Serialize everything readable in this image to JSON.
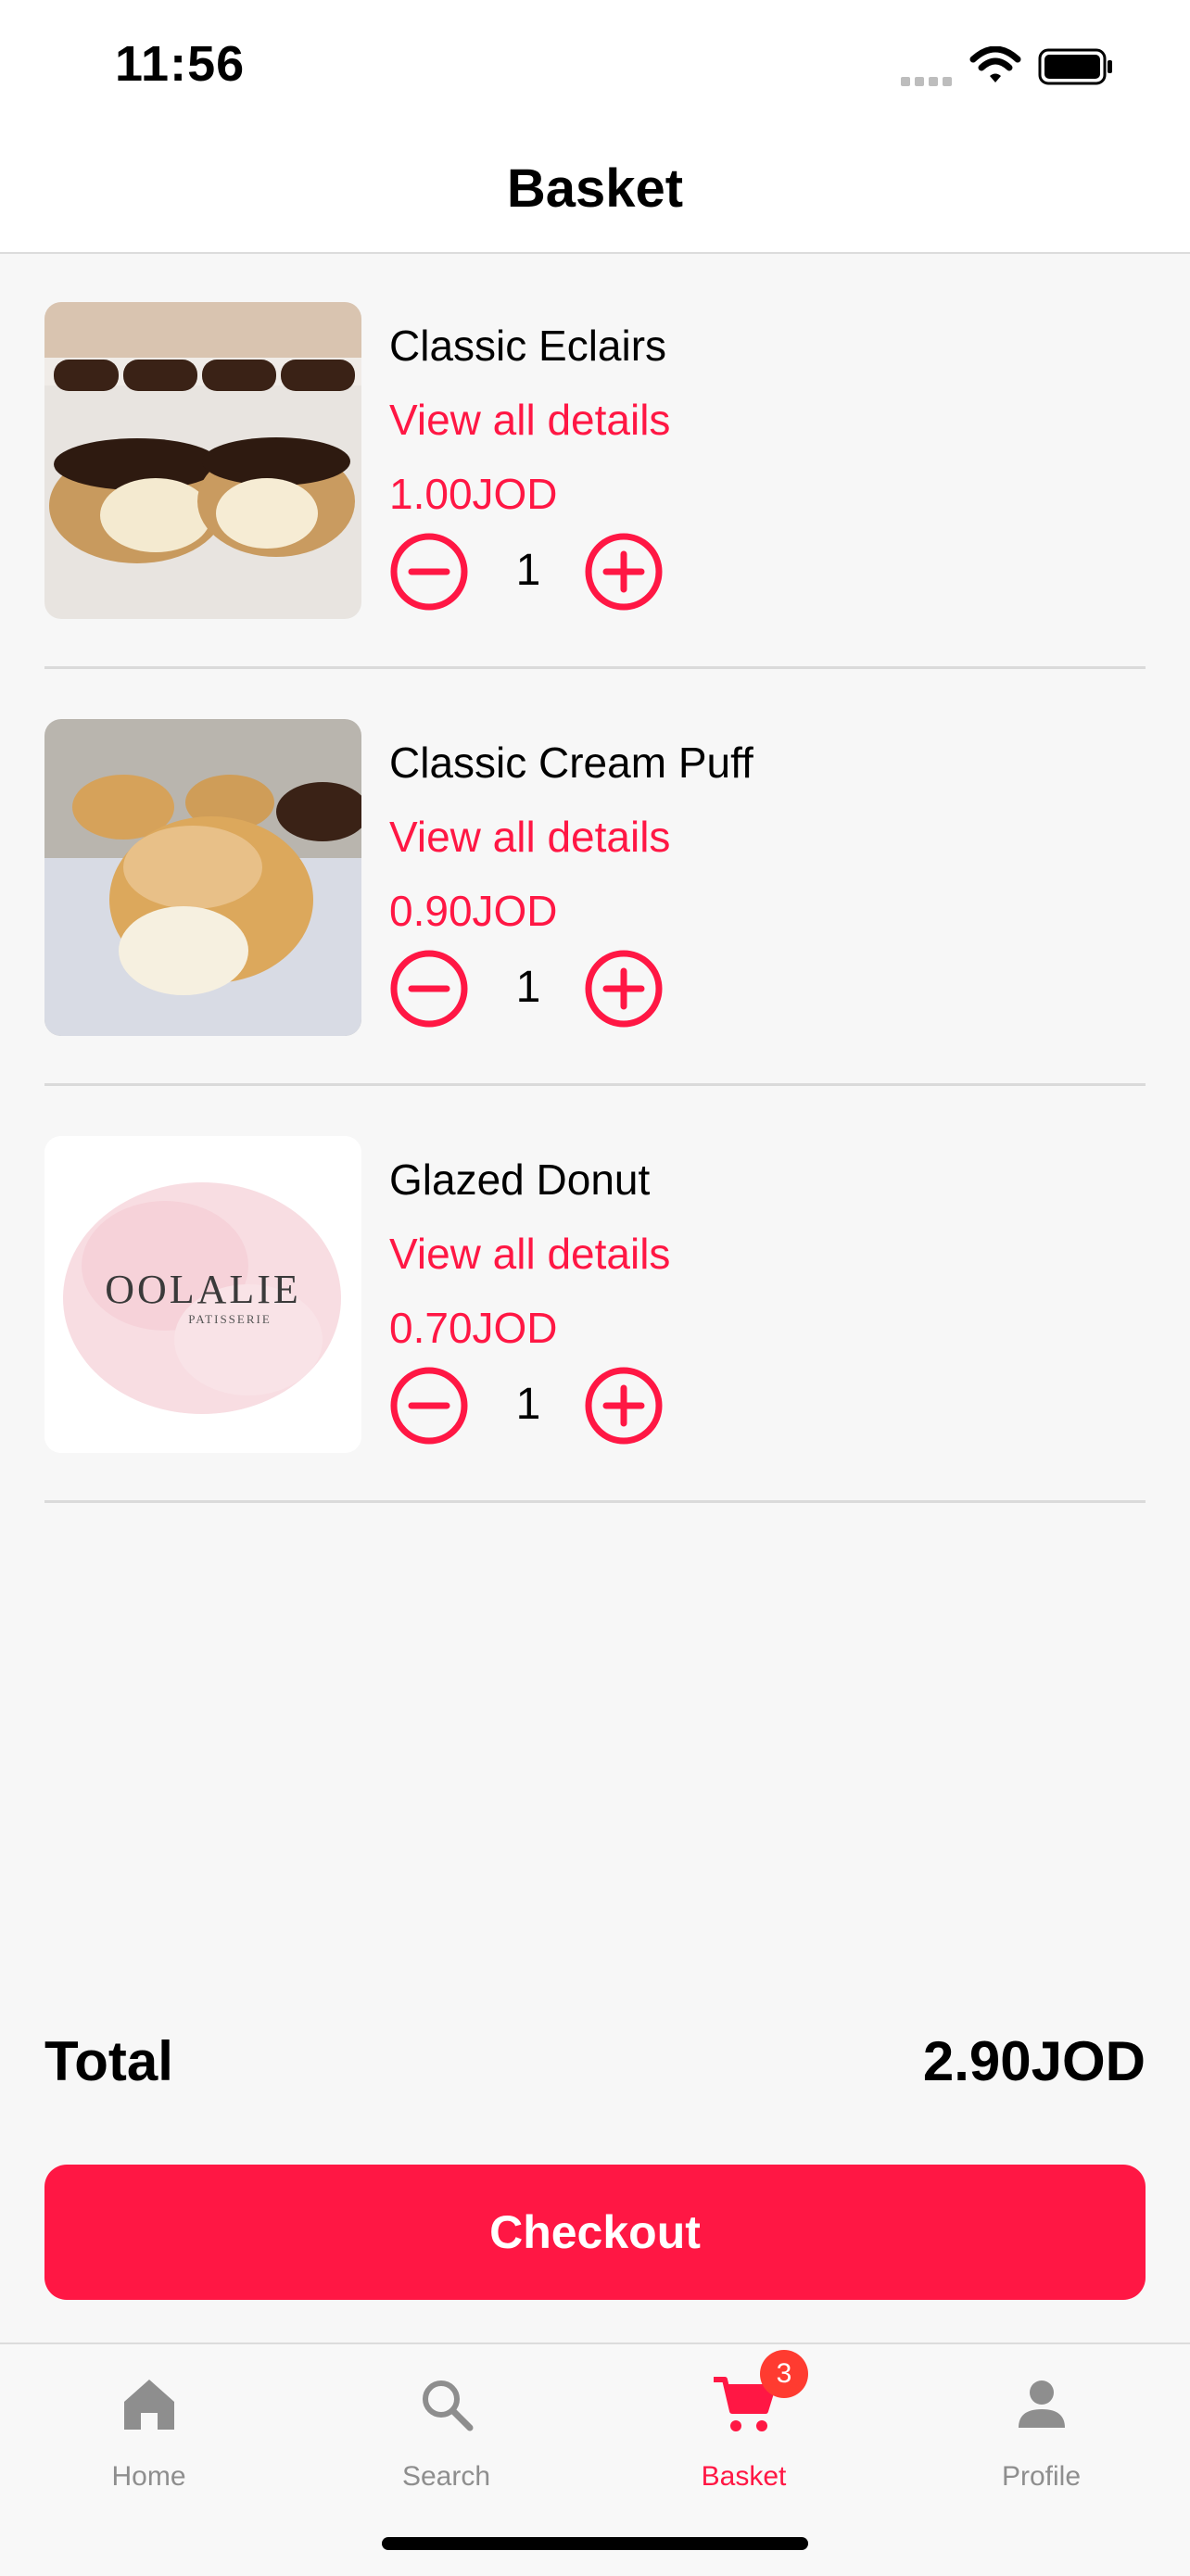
{
  "status": {
    "time": "11:56"
  },
  "header": {
    "title": "Basket"
  },
  "items": [
    {
      "name": "Classic Eclairs",
      "details_label": "View all details",
      "price": "1.00JOD",
      "quantity": "1"
    },
    {
      "name": "Classic Cream Puff",
      "details_label": "View all details",
      "price": "0.90JOD",
      "quantity": "1"
    },
    {
      "name": "Glazed Donut",
      "details_label": "View all details",
      "price": "0.70JOD",
      "quantity": "1",
      "image_logo_text": "OOLALIE",
      "image_logo_subtext": "PATISSERIE"
    }
  ],
  "summary": {
    "total_label": "Total",
    "total_value": "2.90JOD"
  },
  "checkout": {
    "label": "Checkout"
  },
  "tabbar": {
    "tabs": [
      {
        "label": "Home",
        "icon": "home-icon"
      },
      {
        "label": "Search",
        "icon": "search-icon"
      },
      {
        "label": "Basket",
        "icon": "cart-icon",
        "active": true
      },
      {
        "label": "Profile",
        "icon": "person-icon"
      }
    ],
    "basket_badge": "3"
  },
  "colors": {
    "accent": "#ff1744",
    "badge": "#ff3b30",
    "inactive": "#8e8e8e"
  }
}
